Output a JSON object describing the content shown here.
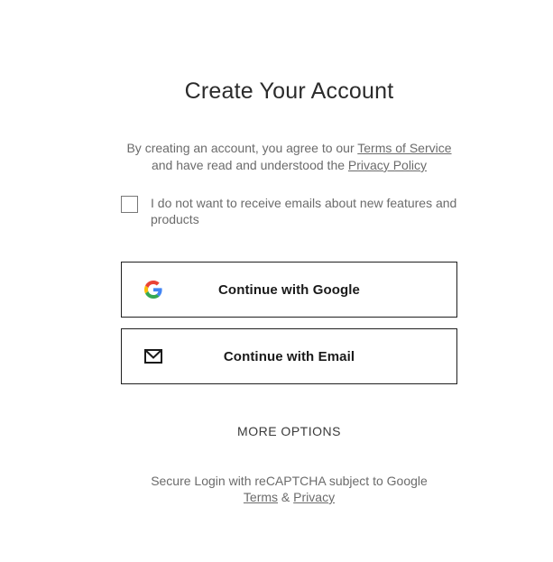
{
  "title": "Create Your Account",
  "terms": {
    "prefix": "By creating an account, you agree to our ",
    "tos_link": "Terms of Service",
    "middle": "and have read and understood the ",
    "privacy_link": "Privacy Policy"
  },
  "optout": {
    "checked": false,
    "label": "I do not want to receive emails about new features and products"
  },
  "buttons": {
    "google": {
      "label": "Continue with Google",
      "icon": "google-icon"
    },
    "email": {
      "label": "Continue with Email",
      "icon": "envelope-icon"
    }
  },
  "more_options": "MORE OPTIONS",
  "recaptcha": {
    "text": "Secure Login with reCAPTCHA subject to Google",
    "terms_link": "Terms",
    "amp": " & ",
    "privacy_link": "Privacy"
  },
  "colors": {
    "text": "#2b2b2b",
    "muted": "#6b6b6b",
    "border": "#1f1f1f",
    "google_blue": "#4285F4",
    "google_red": "#EA4335",
    "google_yellow": "#FBBC05",
    "google_green": "#34A853"
  }
}
